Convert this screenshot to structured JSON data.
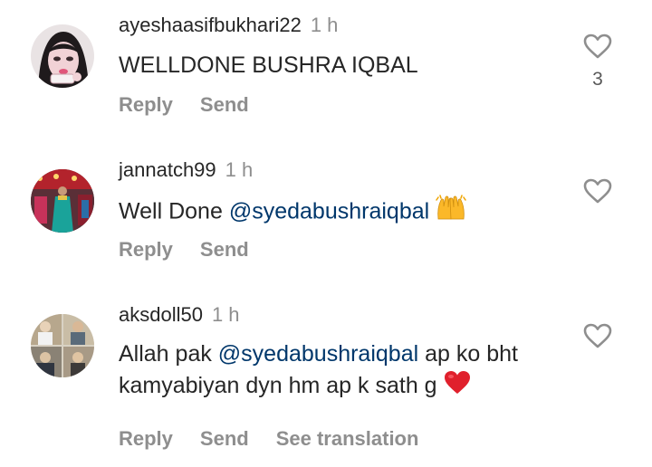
{
  "comments": [
    {
      "username": "ayeshaasifbukhari22",
      "time": "1 h",
      "text": "WELLDONE BUSHRA IQBAL",
      "reply_label": "Reply",
      "send_label": "Send",
      "like_count": "3"
    },
    {
      "username": "jannatch99",
      "time": "1 h",
      "text_before": "Well Done ",
      "mention": "@syedabushraiqbal",
      "text_after": "",
      "emoji": "raising-hands-emoji",
      "reply_label": "Reply",
      "send_label": "Send"
    },
    {
      "username": "aksdoll50",
      "time": "1 h",
      "text_before": "Allah pak ",
      "mention": "@syedabushraiqbal",
      "text_after": " ap ko bht kamyabiyan dyn hm ap k sath g ",
      "emoji": "red-heart-emoji",
      "reply_label": "Reply",
      "send_label": "Send",
      "translate_label": "See translation"
    }
  ],
  "colors": {
    "text": "#262626",
    "secondary": "#8e8e8e",
    "mention": "#00376b",
    "heart": "#ed1c24"
  }
}
